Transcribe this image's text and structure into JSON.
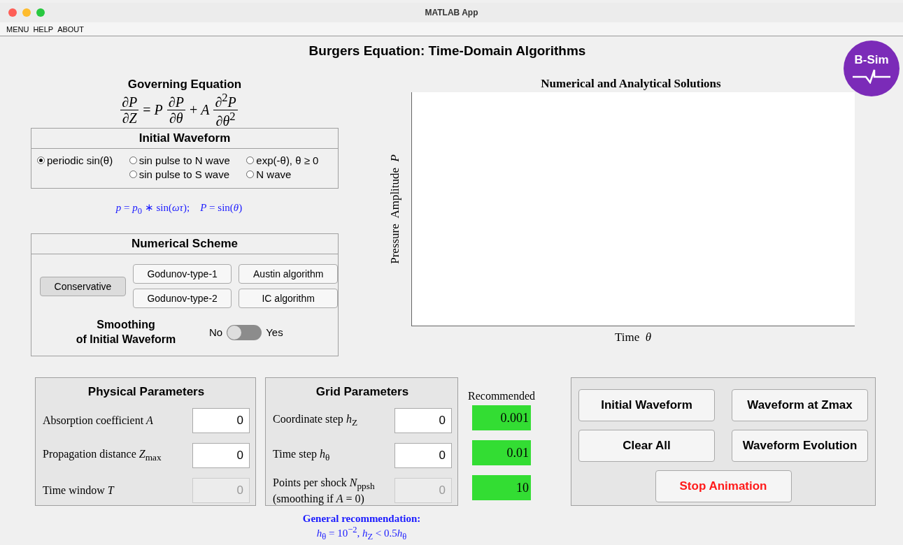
{
  "window": {
    "title": "MATLAB App"
  },
  "menu": [
    "MENU",
    "HELP",
    "ABOUT"
  ],
  "title": "Burgers Equation: Time-Domain Algorithms",
  "logo": {
    "text": "B-Sim"
  },
  "governing": {
    "title": "Governing Equation",
    "equation": [
      {
        "kind": "frac",
        "num": "∂*P*",
        "den": "∂*Z*"
      },
      {
        "kind": "text",
        "text": "= *P*"
      },
      {
        "kind": "frac",
        "num": "∂*P*",
        "den": "∂*θ*"
      },
      {
        "kind": "text",
        "text": "+ *A*"
      },
      {
        "kind": "frac",
        "num": "∂$^{2}$*P*",
        "den": "∂*θ*$^{2}$"
      }
    ]
  },
  "initial_waveform": {
    "title": "Initial Waveform",
    "options": [
      {
        "label": "periodic sin(θ)",
        "selected": true
      },
      {
        "label": "sin pulse to N wave",
        "selected": false
      },
      {
        "label": "exp(-θ), θ ≥ 0",
        "selected": false
      },
      {
        "label": "sin pulse to S wave",
        "selected": false
      },
      {
        "label": "N wave",
        "selected": false
      }
    ]
  },
  "formula": "*p* = *p*$_{0}$ ∗ sin(*ωτ*);    *P* = sin(*θ*)",
  "numerical_scheme": {
    "title": "Numerical Scheme",
    "buttons": [
      {
        "label": "Conservative",
        "selected": true
      },
      {
        "label": "Godunov-type-1",
        "selected": false
      },
      {
        "label": "Austin algorithm",
        "selected": false
      },
      {
        "label": "Godunov-type-2",
        "selected": false
      },
      {
        "label": "IC algorithm",
        "selected": false
      }
    ],
    "smoothing": {
      "lines": [
        "Smoothing",
        "of Initial Waveform"
      ],
      "off_label": "No",
      "on_label": "Yes",
      "on": false
    }
  },
  "plot": {
    "title": "Numerical and Analytical Solutions",
    "xlabel": "Time  *θ*",
    "ylabel": "Pressure  Amplitude  *P*"
  },
  "physical_parameters": {
    "title": "Physical Parameters",
    "rows": [
      {
        "lines": [
          "Absorption coefficient *A*"
        ],
        "value": "0",
        "disabled": false
      },
      {
        "lines": [
          "Propagation distance *Z*$_{max}$"
        ],
        "value": "0",
        "disabled": false
      },
      {
        "lines": [
          "Time window *T*"
        ],
        "value": "0",
        "disabled": true
      }
    ]
  },
  "grid_parameters": {
    "title": "Grid Parameters",
    "rows": [
      {
        "lines": [
          "Coordinate step *h*$_{Z}$"
        ],
        "value": "0",
        "disabled": false
      },
      {
        "lines": [
          "Time step *h*$_{θ}$"
        ],
        "value": "0",
        "disabled": false
      },
      {
        "lines": [
          "Points per shock *N*$_{ppsh}$",
          "(smoothing if *A* = 0)"
        ],
        "value": "0",
        "disabled": true
      }
    ]
  },
  "recommended": {
    "title": "Recommended",
    "values": [
      "0.001",
      "0.01",
      "10"
    ]
  },
  "general_recommendation": {
    "title": "General recommendation:",
    "text": [
      "*h*$_{θ}$ = 10$^{−2}$, *h*$_{Z}$ < 0.5",
      "*h*$_{θ}$"
    ]
  },
  "actions": [
    {
      "label": "Initial Waveform",
      "kind": "normal"
    },
    {
      "label": "Waveform at Zmax",
      "kind": "normal"
    },
    {
      "label": "Clear All",
      "kind": "normal"
    },
    {
      "label": "Waveform Evolution",
      "kind": "normal"
    },
    {
      "label": "Stop Animation",
      "kind": "warning"
    }
  ]
}
